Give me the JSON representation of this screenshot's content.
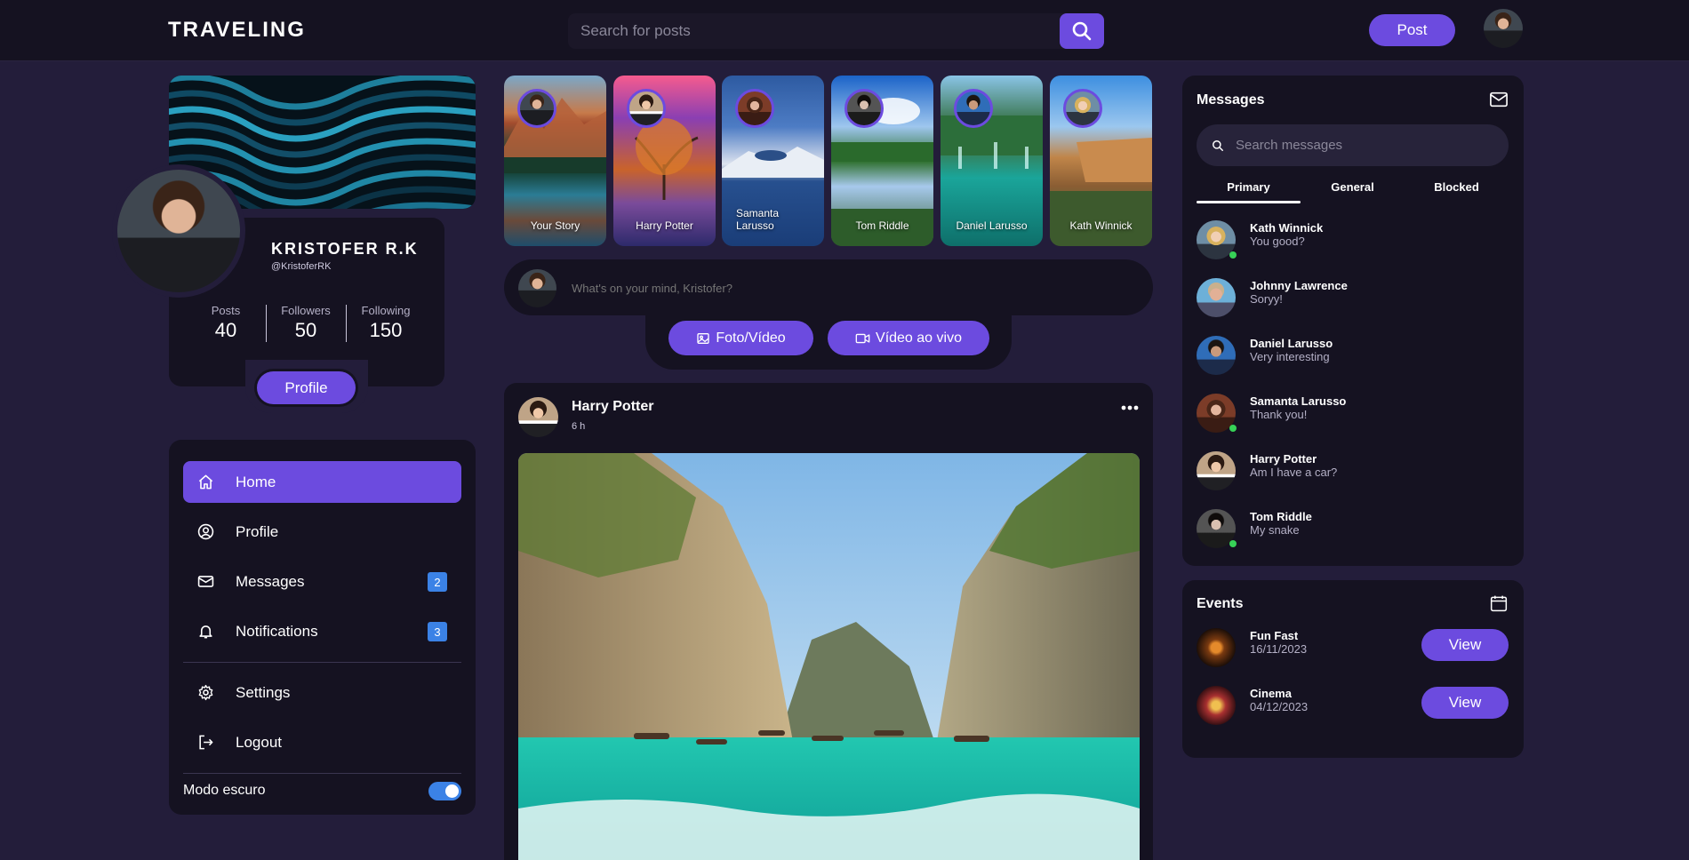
{
  "header": {
    "logo": "TRAVELING",
    "search_placeholder": "Search for posts",
    "post_button": "Post"
  },
  "profile": {
    "name": "KRISTOFER R.K",
    "handle": "@KristoferRK",
    "stats": [
      {
        "label": "Posts",
        "value": "40"
      },
      {
        "label": "Followers",
        "value": "50"
      },
      {
        "label": "Following",
        "value": "150"
      }
    ],
    "profile_button": "Profile"
  },
  "nav": {
    "items": [
      {
        "label": "Home",
        "icon": "home-icon"
      },
      {
        "label": "Profile",
        "icon": "user-circle-icon"
      },
      {
        "label": "Messages",
        "icon": "mail-icon",
        "badge": "2"
      },
      {
        "label": "Notifications",
        "icon": "bell-icon",
        "badge": "3"
      },
      {
        "label": "Settings",
        "icon": "gear-icon"
      },
      {
        "label": "Logout",
        "icon": "logout-icon"
      }
    ],
    "dark_mode_label": "Modo escuro",
    "dark_mode_on": true
  },
  "stories": [
    {
      "name": "Your Story"
    },
    {
      "name": "Harry Potter"
    },
    {
      "name": "Samanta Larusso"
    },
    {
      "name": "Tom Riddle"
    },
    {
      "name": "Daniel Larusso"
    },
    {
      "name": "Kath Winnick"
    }
  ],
  "composer": {
    "placeholder": "What's on your mind, Kristofer?",
    "photo_button": "Foto/Vídeo",
    "live_button": "Vídeo ao vivo"
  },
  "post": {
    "author": "Harry Potter",
    "time": "6 h"
  },
  "messages": {
    "title": "Messages",
    "search_placeholder": "Search messages",
    "tabs": [
      "Primary",
      "General",
      "Blocked"
    ],
    "list": [
      {
        "name": "Kath Winnick",
        "text": "You good?",
        "online": true
      },
      {
        "name": "Johnny Lawrence",
        "text": "Soryy!",
        "online": false
      },
      {
        "name": "Daniel Larusso",
        "text": "Very interesting",
        "online": false
      },
      {
        "name": "Samanta Larusso",
        "text": "Thank you!",
        "online": true
      },
      {
        "name": "Harry Potter",
        "text": "Am I have a car?",
        "online": false
      },
      {
        "name": "Tom Riddle",
        "text": "My snake",
        "online": true
      }
    ]
  },
  "events": {
    "title": "Events",
    "list": [
      {
        "name": "Fun Fast",
        "date": "16/11/2023",
        "button": "View"
      },
      {
        "name": "Cinema",
        "date": "04/12/2023",
        "button": "View"
      }
    ]
  },
  "colors": {
    "accent": "#6c4bdf",
    "background": "#231d3a",
    "card": "#151221",
    "badge": "#3b82e6",
    "online": "#37d157"
  }
}
